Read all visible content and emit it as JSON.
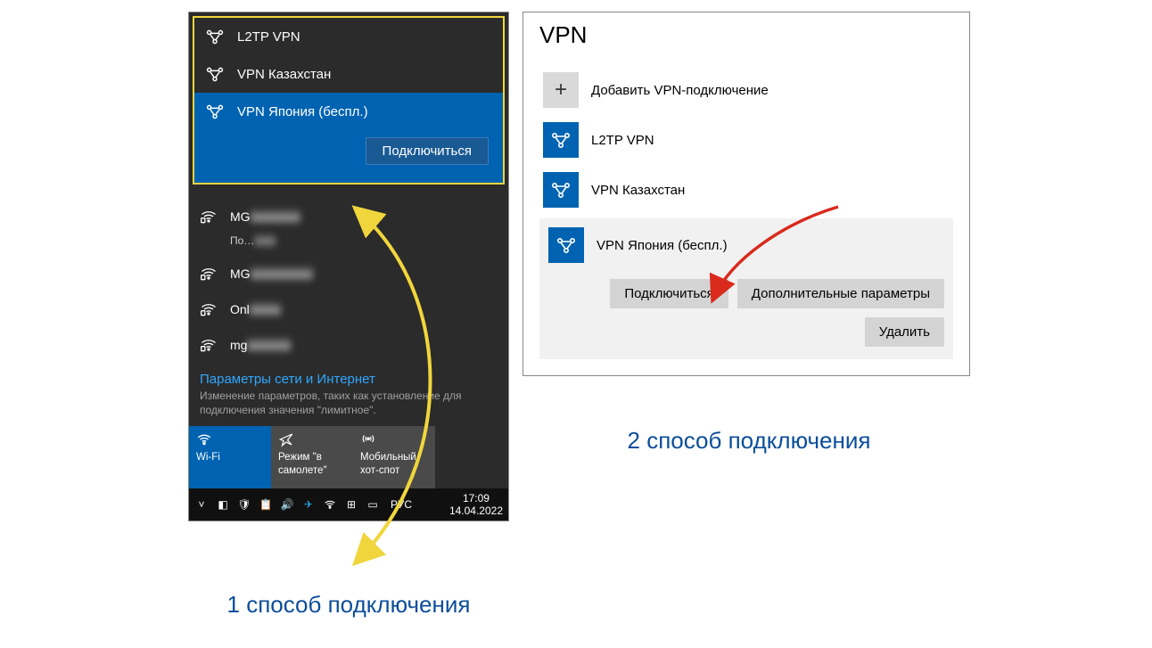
{
  "flyout": {
    "vpn": [
      {
        "label": "L2TP VPN"
      },
      {
        "label": "VPN Казахстан"
      },
      {
        "label": "VPN Япония (беспл.)",
        "selected": true
      }
    ],
    "connect_btn": "Подключиться",
    "wifi": [
      {
        "label": "MG",
        "sub": "По…"
      },
      {
        "label": "MG"
      },
      {
        "label": "Onl"
      },
      {
        "label": "mg"
      }
    ],
    "link": "Параметры сети и Интернет",
    "desc": "Изменение параметров, таких как установление для подключения значения \"лимитное\".",
    "tiles": {
      "wifi": "Wi-Fi",
      "airplane": "Режим \"в самолете\"",
      "hotspot": "Мобильный хот-спот"
    },
    "tray": {
      "lang": "РУС",
      "time": "17:09",
      "date": "14.04.2022"
    }
  },
  "settings": {
    "title": "VPN",
    "add": "Добавить VPN-подключение",
    "items": [
      {
        "label": "L2TP VPN"
      },
      {
        "label": "VPN Казахстан"
      }
    ],
    "selected": {
      "label": "VPN Япония (беспл.)",
      "connect": "Подключиться",
      "advanced": "Дополнительные параметры",
      "delete": "Удалить"
    }
  },
  "captions": {
    "one": "1 способ подключения",
    "two": "2 способ подключения"
  }
}
